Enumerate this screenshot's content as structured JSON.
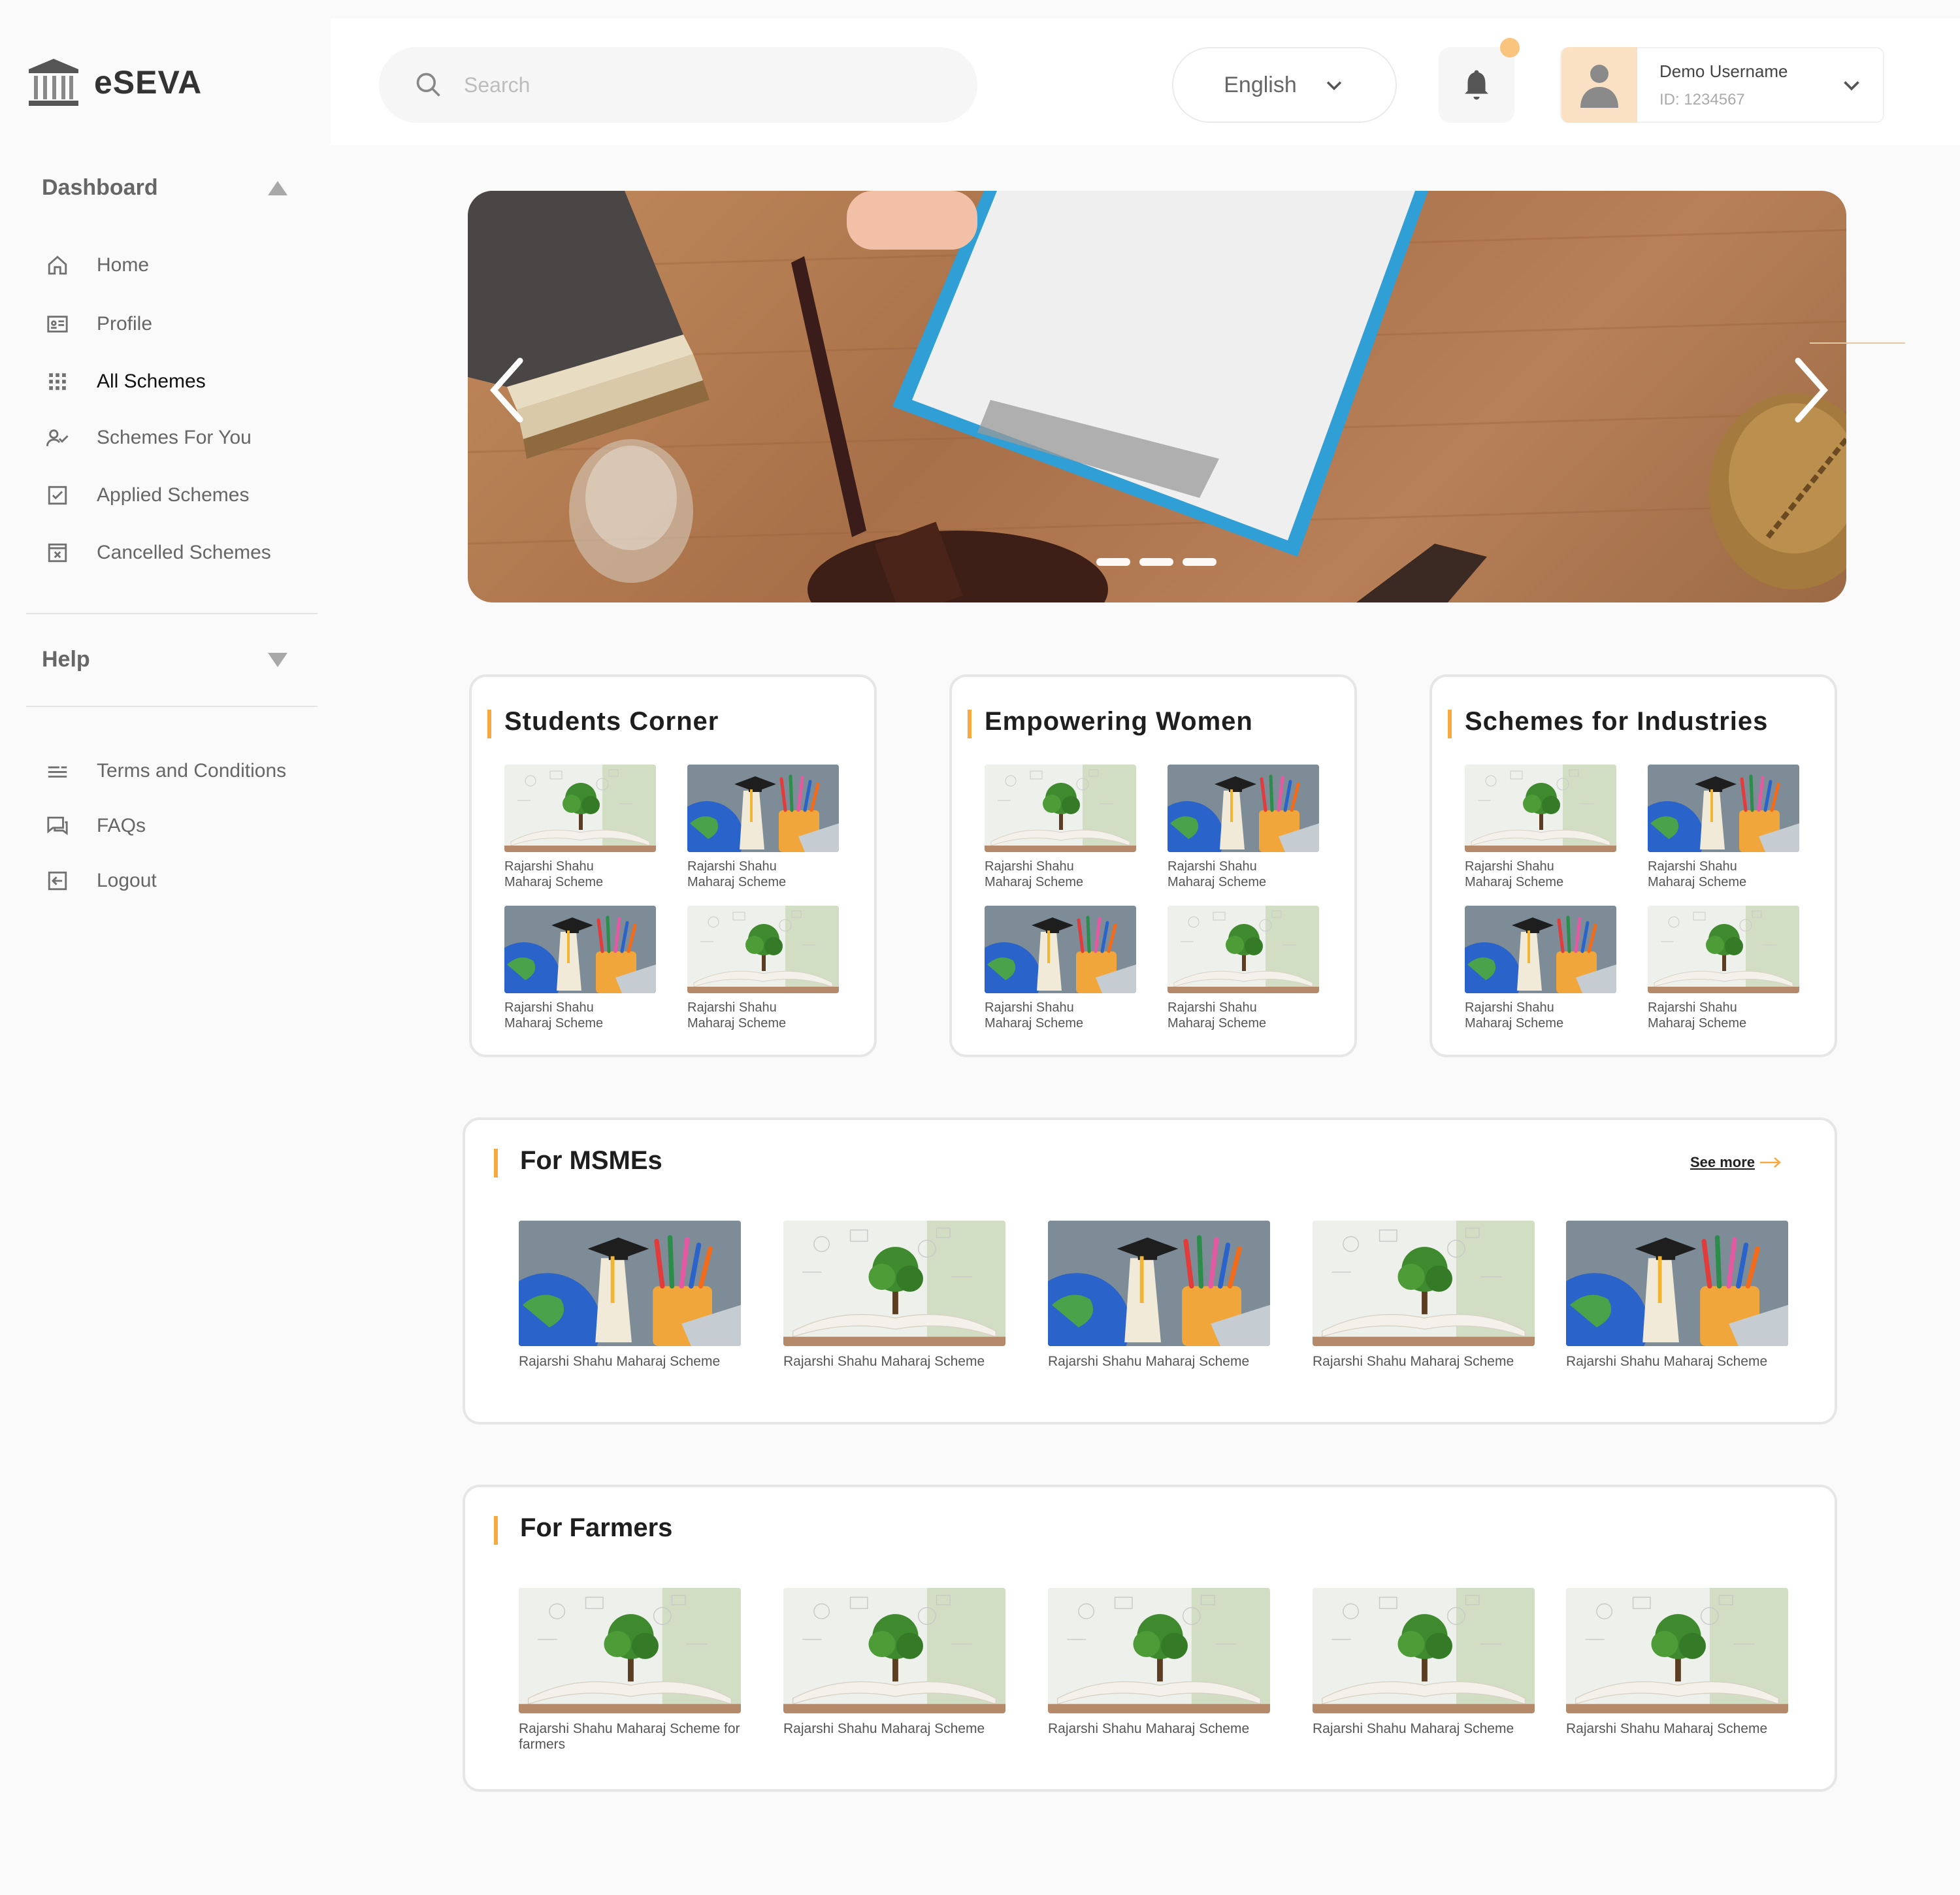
{
  "app": {
    "name": "eSEVA"
  },
  "sidebar": {
    "dashboard_label": "Dashboard",
    "items": [
      {
        "label": "Home",
        "icon": "home-icon"
      },
      {
        "label": "Profile",
        "icon": "id-card-icon"
      },
      {
        "label": "All Schemes",
        "icon": "grid-icon"
      },
      {
        "label": "Schemes For You",
        "icon": "user-check-icon"
      },
      {
        "label": "Applied Schemes",
        "icon": "checkbox-icon"
      },
      {
        "label": "Cancelled Schemes",
        "icon": "close-box-icon"
      }
    ],
    "help_label": "Help",
    "bottom_items": [
      {
        "label": "Terms and Conditions",
        "icon": "lines-icon"
      },
      {
        "label": "FAQs",
        "icon": "chat-icon"
      },
      {
        "label": "Logout",
        "icon": "logout-icon"
      }
    ]
  },
  "header": {
    "search_placeholder": "Search",
    "language": "English",
    "user_name": "Demo Username",
    "user_id": "ID: 1234567"
  },
  "hero": {
    "slides": 3
  },
  "categories": [
    {
      "title": "Students Corner",
      "items": [
        {
          "caption": "Rajarshi Shahu Maharaj Scheme",
          "image": "tree"
        },
        {
          "caption": "Rajarshi Shahu Maharaj Scheme",
          "image": "globe"
        },
        {
          "caption": "Rajarshi Shahu Maharaj Scheme",
          "image": "globe"
        },
        {
          "caption": "Rajarshi Shahu Maharaj Scheme",
          "image": "tree"
        }
      ]
    },
    {
      "title": "Empowering Women",
      "items": [
        {
          "caption": "Rajarshi Shahu Maharaj Scheme",
          "image": "tree"
        },
        {
          "caption": "Rajarshi Shahu Maharaj Scheme",
          "image": "globe"
        },
        {
          "caption": "Rajarshi Shahu Maharaj Scheme",
          "image": "globe"
        },
        {
          "caption": "Rajarshi Shahu Maharaj Scheme",
          "image": "tree"
        }
      ]
    },
    {
      "title": "Schemes for Industries",
      "items": [
        {
          "caption": "Rajarshi Shahu Maharaj Scheme",
          "image": "tree"
        },
        {
          "caption": "Rajarshi Shahu Maharaj Scheme",
          "image": "globe"
        },
        {
          "caption": "Rajarshi Shahu Maharaj Scheme",
          "image": "globe"
        },
        {
          "caption": "Rajarshi Shahu Maharaj Scheme",
          "image": "tree"
        }
      ]
    }
  ],
  "msmes": {
    "title": "For MSMEs",
    "see_more": "See more",
    "items": [
      {
        "caption": "Rajarshi Shahu Maharaj Scheme",
        "image": "globe"
      },
      {
        "caption": "Rajarshi Shahu Maharaj Scheme",
        "image": "tree"
      },
      {
        "caption": "Rajarshi Shahu Maharaj Scheme",
        "image": "globe"
      },
      {
        "caption": "Rajarshi Shahu Maharaj Scheme",
        "image": "tree"
      },
      {
        "caption": "Rajarshi Shahu Maharaj Scheme",
        "image": "globe"
      }
    ]
  },
  "farmers": {
    "title": "For Farmers",
    "items": [
      {
        "caption": "Rajarshi Shahu Maharaj Scheme for farmers",
        "image": "tree"
      },
      {
        "caption": "Rajarshi Shahu Maharaj Scheme",
        "image": "tree"
      },
      {
        "caption": "Rajarshi Shahu Maharaj Scheme",
        "image": "tree"
      },
      {
        "caption": "Rajarshi Shahu Maharaj Scheme",
        "image": "tree"
      },
      {
        "caption": "Rajarshi Shahu Maharaj Scheme",
        "image": "tree"
      }
    ]
  },
  "colors": {
    "accent": "#f7a940",
    "avatar_bg": "#fbe1c4",
    "notification": "#f9c47e"
  }
}
